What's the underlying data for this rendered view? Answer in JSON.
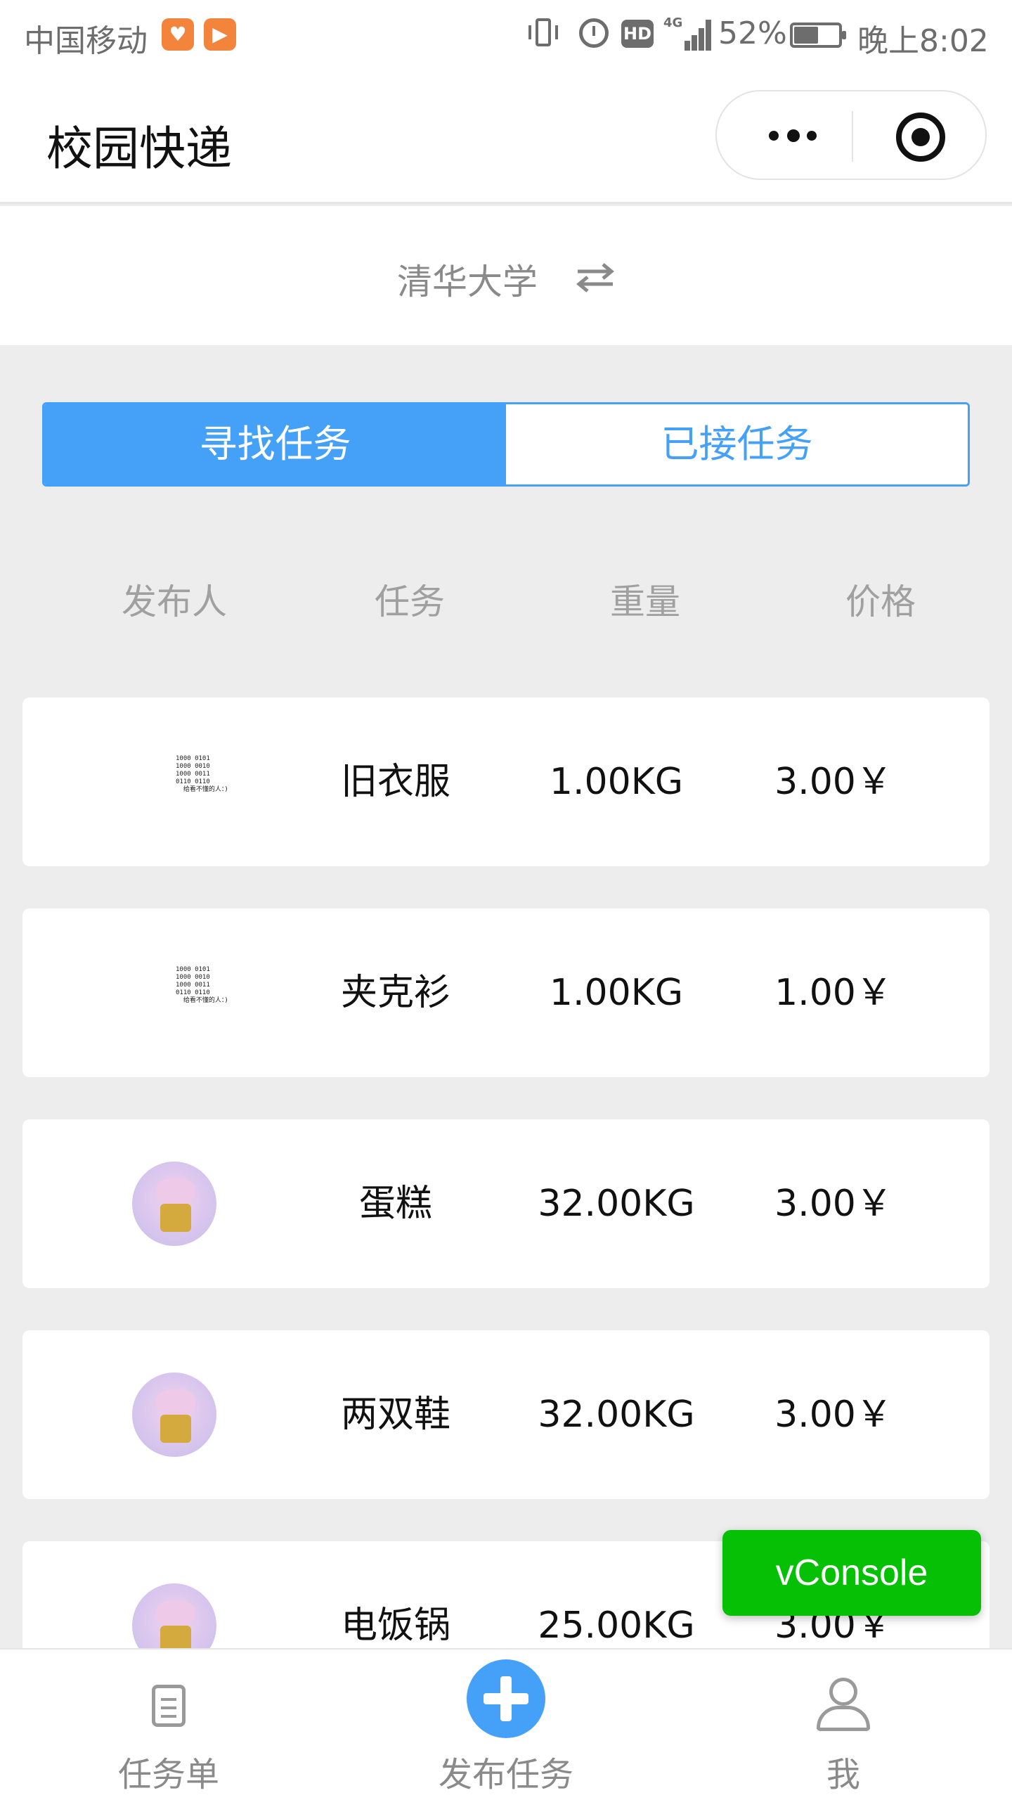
{
  "status_bar": {
    "carrier": "中国移动",
    "battery": "52%",
    "time": "晚上8:02",
    "network": "4G",
    "hd": "HD",
    "icons": [
      "heart-app-icon",
      "play-app-icon",
      "vibrate-icon",
      "alarm-icon",
      "hd-icon",
      "signal-icon",
      "battery-icon"
    ]
  },
  "nav": {
    "title": "校园快递",
    "icons": [
      "more-icon",
      "close-icon"
    ]
  },
  "school": {
    "name": "清华大学",
    "icon": "switch-icon"
  },
  "tabs": [
    {
      "label": "寻找任务",
      "active": true
    },
    {
      "label": "已接任务",
      "active": false
    }
  ],
  "table_header": {
    "publisher": "发布人",
    "task": "任务",
    "weight": "重量",
    "price": "价格"
  },
  "avatar_binary_text": "1000 0101\n1000 0010\n1000 0011\n0110 0110\n  给看不懂的人：)",
  "tasks": [
    {
      "avatar": "binary",
      "task": "旧衣服",
      "weight": "1.00KG",
      "price": "3.00￥"
    },
    {
      "avatar": "binary",
      "task": "夹克衫",
      "weight": "1.00KG",
      "price": "1.00￥"
    },
    {
      "avatar": "pig",
      "task": "蛋糕",
      "weight": "32.00KG",
      "price": "3.00￥"
    },
    {
      "avatar": "pig",
      "task": "两双鞋",
      "weight": "32.00KG",
      "price": "3.00￥"
    },
    {
      "avatar": "pig",
      "task": "电饭锅",
      "weight": "25.00KG",
      "price": "3.00￥"
    }
  ],
  "vconsole": {
    "label": "vConsole"
  },
  "tabbar": [
    {
      "label": "任务单",
      "icon": "list-icon"
    },
    {
      "label": "发布任务",
      "icon": "plus-icon"
    },
    {
      "label": "我",
      "icon": "user-icon"
    }
  ],
  "colors": {
    "accent": "#45a1f8",
    "vconsole": "#05c005",
    "page_bg": "#ededed",
    "muted_text": "#8a8a8a"
  }
}
